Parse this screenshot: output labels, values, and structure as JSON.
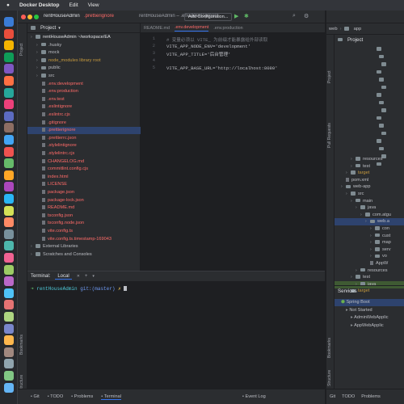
{
  "menubar": {
    "app_name": "Docker Desktop",
    "items": [
      "Edit",
      "View"
    ]
  },
  "left_window": {
    "title": "rentHouseAdmin – .env.development",
    "breadcrumb_project": "rentHouseAdmin",
    "breadcrumb_file": ".prettierignore",
    "add_config_label": "Add Configuration...",
    "project_header": "Project",
    "tree": [
      {
        "label": "rentHouseAdmin ~/workspace/EA",
        "type": "folder",
        "indent": 0,
        "color": "#dfe1e5"
      },
      {
        "label": ".husky",
        "type": "folder",
        "indent": 1,
        "color": "#bcbec4"
      },
      {
        "label": "mock",
        "type": "folder",
        "indent": 1,
        "color": "#bcbec4"
      },
      {
        "label": "node_modules  library root",
        "type": "folder",
        "indent": 1,
        "color": "#c79a3e"
      },
      {
        "label": "public",
        "type": "folder",
        "indent": 1,
        "color": "#bcbec4"
      },
      {
        "label": "src",
        "type": "folder",
        "indent": 1,
        "color": "#bcbec4"
      },
      {
        "label": ".env.development",
        "type": "file",
        "indent": 2,
        "color": "#ff6b68"
      },
      {
        "label": ".env.production",
        "type": "file",
        "indent": 2,
        "color": "#ff6b68"
      },
      {
        "label": ".env.test",
        "type": "file",
        "indent": 2,
        "color": "#ff6b68"
      },
      {
        "label": ".eslintignore",
        "type": "file",
        "indent": 2,
        "color": "#ff6b68"
      },
      {
        "label": ".eslintrc.cjs",
        "type": "file",
        "indent": 2,
        "color": "#ff6b68"
      },
      {
        "label": ".gitignore",
        "type": "file",
        "indent": 2,
        "color": "#ff6b68"
      },
      {
        "label": ".prettierignore",
        "type": "file",
        "indent": 2,
        "color": "#ff6b68",
        "selected": true
      },
      {
        "label": ".prettierrc.json",
        "type": "file",
        "indent": 2,
        "color": "#ff6b68"
      },
      {
        "label": ".stylelintignore",
        "type": "file",
        "indent": 2,
        "color": "#ff6b68"
      },
      {
        "label": ".stylelintrc.cjs",
        "type": "file",
        "indent": 2,
        "color": "#ff6b68"
      },
      {
        "label": "CHANGELOG.md",
        "type": "file",
        "indent": 2,
        "color": "#ff6b68"
      },
      {
        "label": "commitlint.config.cjs",
        "type": "file",
        "indent": 2,
        "color": "#ff6b68"
      },
      {
        "label": "index.html",
        "type": "file",
        "indent": 2,
        "color": "#ff6b68"
      },
      {
        "label": "LICENSE",
        "type": "file",
        "indent": 2,
        "color": "#ff6b68"
      },
      {
        "label": "package.json",
        "type": "file",
        "indent": 2,
        "color": "#ff6b68"
      },
      {
        "label": "package-lock.json",
        "type": "file",
        "indent": 2,
        "color": "#ff6b68"
      },
      {
        "label": "README.md",
        "type": "file",
        "indent": 2,
        "color": "#ff6b68"
      },
      {
        "label": "tsconfig.json",
        "type": "file",
        "indent": 2,
        "color": "#ff6b68"
      },
      {
        "label": "tsconfig.node.json",
        "type": "file",
        "indent": 2,
        "color": "#ff6b68"
      },
      {
        "label": "vite.config.ts",
        "type": "file",
        "indent": 2,
        "color": "#ff6b68"
      },
      {
        "label": "vite.config.ts.timestamp-169043",
        "type": "file",
        "indent": 2,
        "color": "#ff6b68"
      },
      {
        "label": "External Libraries",
        "type": "folder",
        "indent": 0,
        "color": "#bcbec4"
      },
      {
        "label": "Scratches and Consoles",
        "type": "folder",
        "indent": 0,
        "color": "#bcbec4"
      }
    ],
    "editor_tabs": [
      {
        "label": "README.md",
        "active": false
      },
      {
        "label": ".env.development",
        "active": true
      },
      {
        "label": ".env.production",
        "active": false
      }
    ],
    "code_lines": [
      {
        "num": "1",
        "text": "# 变量必须以 VITE_ 为前缀才能暴露给外部读取",
        "comment": true
      },
      {
        "num": "2",
        "text": "VITE_APP_NODE_ENV='development'",
        "comment": false
      },
      {
        "num": "3",
        "text": "VITE_APP_TITLE='后台管理'",
        "comment": false
      },
      {
        "num": "4",
        "text": "",
        "comment": false
      },
      {
        "num": "5",
        "text": "VITE_APP_BASE_URL='http://localhost:8080'",
        "comment": false
      }
    ],
    "terminal": {
      "title": "Terminal:",
      "tab": "Local",
      "prompt_dir": "rentHouseAdmin",
      "prompt_git": "git:(master)",
      "prompt_symbol": "✗"
    },
    "statusbar": [
      "Git",
      "TODO",
      "Problems",
      "Terminal",
      "Event Log"
    ]
  },
  "right_window": {
    "breadcrumb": [
      "web",
      "app"
    ],
    "project_header": "Project",
    "tree": [
      {
        "label": "resources",
        "indent": 3,
        "type": "folder",
        "color": "#bcbec4"
      },
      {
        "label": "test",
        "indent": 3,
        "type": "folder",
        "color": "#bcbec4"
      },
      {
        "label": "target",
        "indent": 2,
        "type": "folder",
        "color": "#c79a3e"
      },
      {
        "label": "pom.xml",
        "indent": 2,
        "type": "file",
        "color": "#bcbec4"
      },
      {
        "label": "web-app",
        "indent": 1,
        "type": "folder",
        "color": "#bcbec4"
      },
      {
        "label": "src",
        "indent": 2,
        "type": "folder",
        "color": "#bcbec4"
      },
      {
        "label": "main",
        "indent": 3,
        "type": "folder",
        "color": "#bcbec4"
      },
      {
        "label": "java",
        "indent": 4,
        "type": "folder",
        "color": "#bcbec4"
      },
      {
        "label": "com.atgu",
        "indent": 5,
        "type": "folder",
        "color": "#bcbec4"
      },
      {
        "label": "web.a",
        "indent": 6,
        "type": "folder",
        "color": "#bcbec4",
        "selected": true
      },
      {
        "label": "con",
        "indent": 7,
        "type": "folder",
        "color": "#bcbec4"
      },
      {
        "label": "cust",
        "indent": 7,
        "type": "folder",
        "color": "#bcbec4"
      },
      {
        "label": "map",
        "indent": 7,
        "type": "folder",
        "color": "#bcbec4"
      },
      {
        "label": "serv",
        "indent": 7,
        "type": "folder",
        "color": "#bcbec4"
      },
      {
        "label": "vo",
        "indent": 7,
        "type": "folder",
        "color": "#bcbec4"
      },
      {
        "label": "AppW",
        "indent": 7,
        "type": "file",
        "color": "#bcbec4"
      },
      {
        "label": "resources",
        "indent": 4,
        "type": "folder",
        "color": "#bcbec4"
      },
      {
        "label": "test",
        "indent": 3,
        "type": "folder",
        "color": "#bcbec4"
      },
      {
        "label": "java",
        "indent": 4,
        "type": "folder",
        "color": "#bcbec4",
        "highlight": true
      },
      {
        "label": "target",
        "indent": 2,
        "type": "folder",
        "color": "#c79a3e"
      }
    ],
    "services": {
      "title": "Services",
      "items": [
        {
          "label": "Spring Boot",
          "indent": 1
        },
        {
          "label": "Not Started",
          "indent": 2
        },
        {
          "label": "AdminWebApplic",
          "indent": 3
        },
        {
          "label": "AppWebApplic",
          "indent": 3
        }
      ]
    },
    "statusbar": [
      "Git",
      "TODO",
      "Problems"
    ]
  }
}
